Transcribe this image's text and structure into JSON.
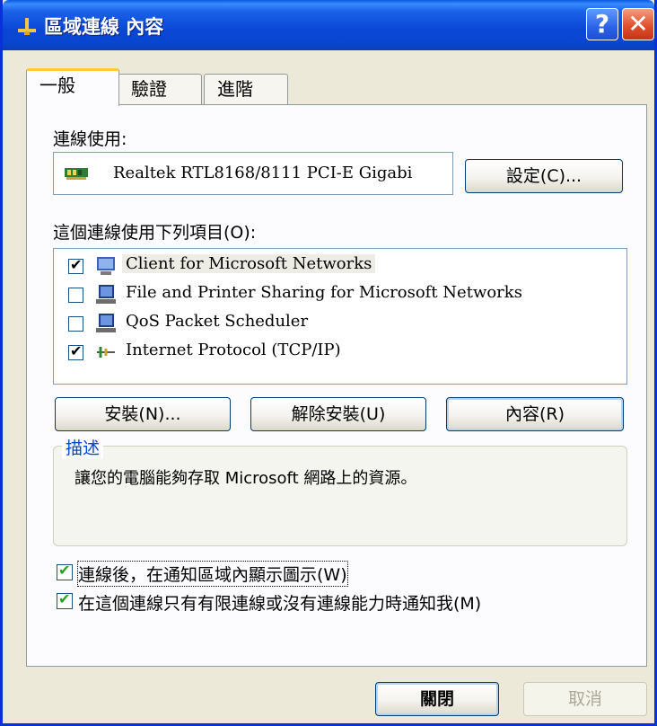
{
  "window": {
    "title": "區域連線 內容",
    "help_label": "?",
    "close_label": "✕"
  },
  "tabs": [
    {
      "label": "一般",
      "active": true
    },
    {
      "label": "驗證",
      "active": false
    },
    {
      "label": "進階",
      "active": false
    }
  ],
  "general": {
    "connect_using_label": "連線使用:",
    "adapter_name": "Realtek RTL8168/8111 PCI-E Gigabi",
    "configure_label": "設定(C)...",
    "items_label": "這個連線使用下列項目(O):",
    "items": [
      {
        "label": "Client for Microsoft Networks",
        "checked": true,
        "selected": true,
        "icon": "network-client-icon"
      },
      {
        "label": "File and Printer Sharing for Microsoft Networks",
        "checked": false,
        "selected": false,
        "icon": "network-service-icon"
      },
      {
        "label": "QoS Packet Scheduler",
        "checked": false,
        "selected": false,
        "icon": "network-service-icon"
      },
      {
        "label": "Internet Protocol (TCP/IP)",
        "checked": true,
        "selected": false,
        "icon": "protocol-icon"
      }
    ],
    "install_label": "安裝(N)...",
    "uninstall_label": "解除安裝(U)",
    "properties_label": "內容(R)",
    "description_title": "描述",
    "description_text": "讓您的電腦能夠存取 Microsoft 網路上的資源。",
    "show_icon_label": "連線後，在通知區域內顯示圖示(W)",
    "show_icon_checked": true,
    "notify_label": "在這個連線只有有限連線或沒有連線能力時通知我(M)",
    "notify_checked": true
  },
  "footer": {
    "close_label": "關閉",
    "cancel_label": "取消"
  },
  "colors": {
    "titlebar": "#0a46d4",
    "dialog_bg": "#ece9d8",
    "tab_highlight": "#ffc83c",
    "group_title": "#0046d5",
    "checkmark_green": "#21a121"
  }
}
